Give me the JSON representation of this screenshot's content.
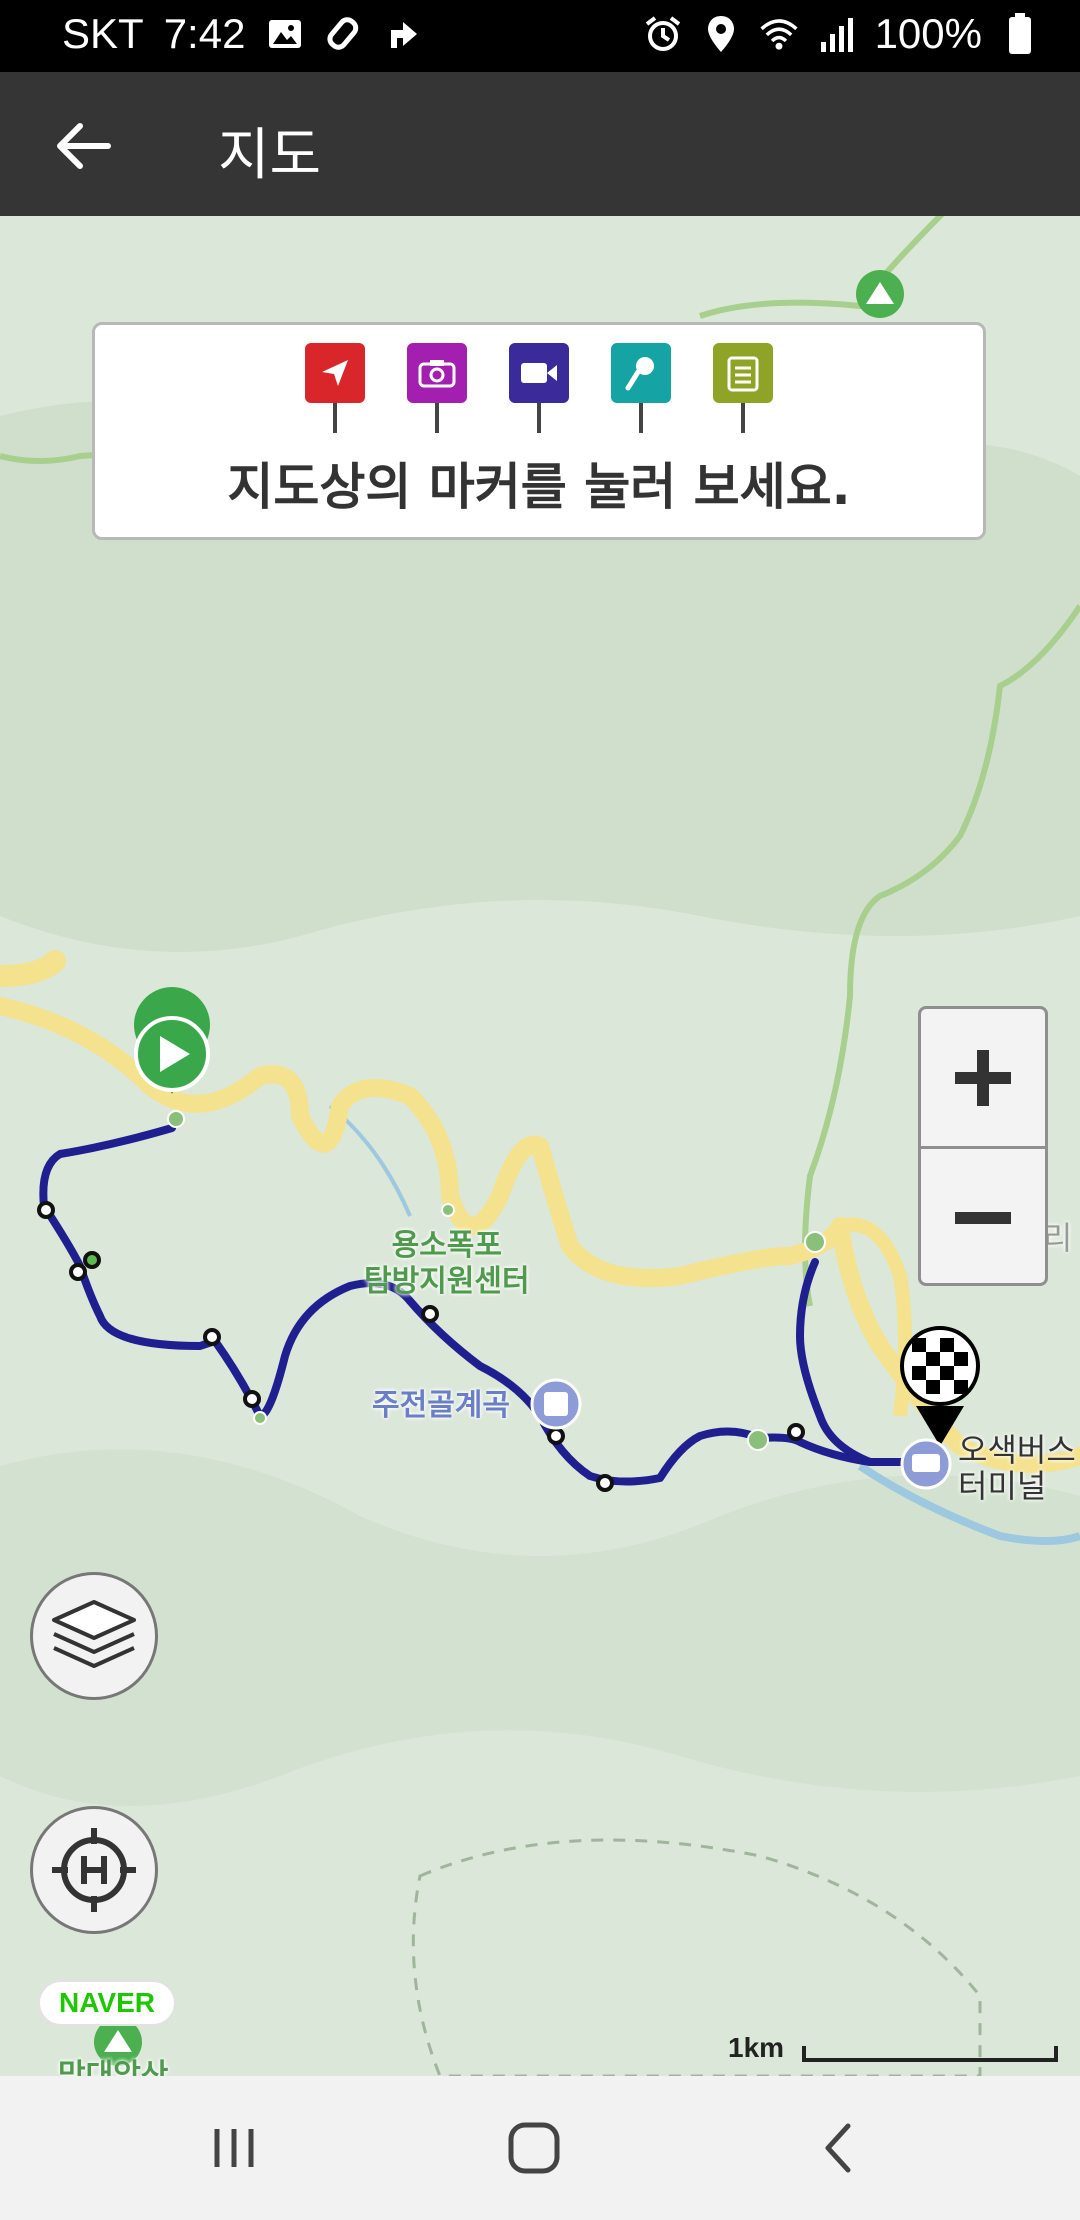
{
  "status": {
    "carrier": "SKT",
    "time": "7:42",
    "battery": "100%",
    "icons_left": [
      "image-icon",
      "tag-icon",
      "navigation-icon"
    ],
    "icons_right": [
      "alarm-icon",
      "location-icon",
      "wifi-icon",
      "signal-icon",
      "battery-icon"
    ]
  },
  "appbar": {
    "title": "지도",
    "back_icon": "arrow-left-icon"
  },
  "info_box": {
    "message": "지도상의 마커를 눌러 보세요.",
    "markers": [
      {
        "name": "direction-marker",
        "color": "#d9262b"
      },
      {
        "name": "camera-marker",
        "color": "#a21fb0"
      },
      {
        "name": "video-marker",
        "color": "#3b2a9a"
      },
      {
        "name": "microphone-marker",
        "color": "#16a3a3"
      },
      {
        "name": "note-marker",
        "color": "#8fa326"
      }
    ]
  },
  "map": {
    "labels": {
      "visitor_center": "용소폭포\n탐방지원센터",
      "valley": "주전골계곡",
      "bus_terminal": "오색버스\n터미널",
      "edge_name": "오색리",
      "bottom_place": "망대암산"
    },
    "route_color": "#1f1f8f",
    "scale_label": "1km",
    "provider": "NAVER"
  },
  "controls": {
    "zoom_in": "+",
    "zoom_out": "−"
  },
  "nav": {
    "recents_icon": "recents-icon",
    "home_icon": "home-icon",
    "back_icon": "back-chevron-icon"
  }
}
